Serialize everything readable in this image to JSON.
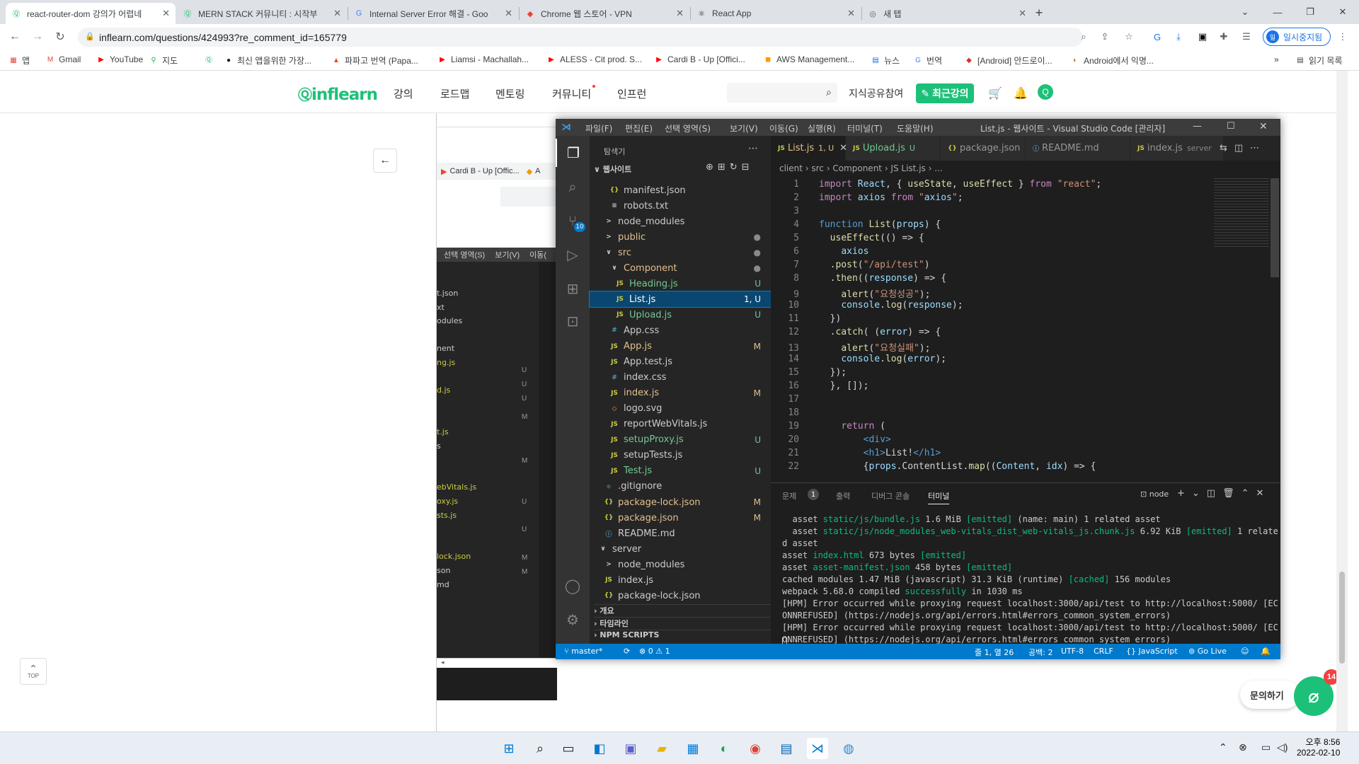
{
  "browser": {
    "tabs": [
      {
        "title": "react-router-dom 강의가 어렵네",
        "favicon": "inflearn-icon",
        "active": true
      },
      {
        "title": "MERN STACK 커뮤니티 : 시작부",
        "favicon": "inflearn-icon",
        "active": false
      },
      {
        "title": "Internal Server Error 해결 - Goo",
        "favicon": "google-icon",
        "active": false
      },
      {
        "title": "Chrome 웹 스토어 - VPN",
        "favicon": "chrome-store-icon",
        "active": false
      },
      {
        "title": "React App",
        "favicon": "react-icon",
        "active": false
      },
      {
        "title": "새 탭",
        "favicon": "chrome-icon",
        "active": false
      }
    ],
    "url": "inflearn.com/questions/424993?re_comment_id=165779",
    "profile_label": "일시중지됨",
    "bookmarks": [
      "앱",
      "Gmail",
      "YouTube",
      "지도",
      "",
      "최신 앱을위한 가장...",
      "파파고 번역 (Papa...",
      "Liamsi - Machallah...",
      "ALESS - Cit prod. S...",
      "Cardi B - Up [Offici...",
      "AWS Management...",
      "뉴스",
      "번역",
      "[Android] 안드로이...",
      "Android에서 익명..."
    ],
    "bookmarks_more": "»",
    "reading_list": "읽기 목록"
  },
  "inflearn": {
    "logo": "inflearn",
    "nav": [
      "강의",
      "로드맵",
      "멘토링",
      "커뮤니티",
      "인프런"
    ],
    "share_label": "지식공유참여",
    "recent_label": "최근강의",
    "top_label": "TOP",
    "inquiry_label": "문의하기",
    "inquiry_badge": "14",
    "embedded_tabs": [
      "Cardi B - Up [Offic...",
      "A"
    ],
    "embedded_menu": [
      "선택 영역(S)",
      "보기(V)",
      "이동("
    ],
    "embedded_files": [
      "t.json",
      "xt",
      "odules",
      "",
      "nent",
      "ng.js",
      "",
      "d.js",
      "",
      "",
      "t.js",
      "s",
      "",
      "",
      "ebVitals.js",
      "oxy.js",
      "sts.js",
      "",
      "",
      "lock.json",
      "son",
      "md"
    ],
    "embedded_status": [
      "U",
      "U",
      "U",
      "M",
      "M",
      "U",
      "U",
      "M",
      "M"
    ]
  },
  "vscode": {
    "title": "List.js - 웹사이트 - Visual Studio Code [관리자]",
    "menu": [
      "파일(F)",
      "편집(E)",
      "선택 영역(S)",
      "보기(V)",
      "이동(G)",
      "실행(R)",
      "터미널(T)",
      "도움말(H)"
    ],
    "explorer_title": "탐색기",
    "workspace": "웹사이트",
    "tree": [
      {
        "name": "manifest.json",
        "icon": "{}",
        "indent": 2,
        "status": ""
      },
      {
        "name": "robots.txt",
        "icon": "≡",
        "indent": 2,
        "status": ""
      },
      {
        "name": "node_modules",
        "icon": ">",
        "indent": 1,
        "status": ""
      },
      {
        "name": "public",
        "icon": ">",
        "indent": 1,
        "status": "●"
      },
      {
        "name": "src",
        "icon": "∨",
        "indent": 1,
        "status": "●"
      },
      {
        "name": "Component",
        "icon": "∨",
        "indent": 2,
        "status": "●"
      },
      {
        "name": "Heading.js",
        "icon": "JS",
        "indent": 3,
        "status": "U"
      },
      {
        "name": "List.js",
        "icon": "JS",
        "indent": 3,
        "status": "1, U"
      },
      {
        "name": "Upload.js",
        "icon": "JS",
        "indent": 3,
        "status": "U"
      },
      {
        "name": "App.css",
        "icon": "#",
        "indent": 2,
        "status": ""
      },
      {
        "name": "App.js",
        "icon": "JS",
        "indent": 2,
        "status": "M"
      },
      {
        "name": "App.test.js",
        "icon": "JS",
        "indent": 2,
        "status": ""
      },
      {
        "name": "index.css",
        "icon": "#",
        "indent": 2,
        "status": ""
      },
      {
        "name": "index.js",
        "icon": "JS",
        "indent": 2,
        "status": "M"
      },
      {
        "name": "logo.svg",
        "icon": "◇",
        "indent": 2,
        "status": ""
      },
      {
        "name": "reportWebVitals.js",
        "icon": "JS",
        "indent": 2,
        "status": ""
      },
      {
        "name": "setupProxy.js",
        "icon": "JS",
        "indent": 2,
        "status": "U"
      },
      {
        "name": "setupTests.js",
        "icon": "JS",
        "indent": 2,
        "status": ""
      },
      {
        "name": "Test.js",
        "icon": "JS",
        "indent": 2,
        "status": "U"
      },
      {
        "name": ".gitignore",
        "icon": "◆",
        "indent": 1,
        "status": ""
      },
      {
        "name": "package-lock.json",
        "icon": "{}",
        "indent": 1,
        "status": "M"
      },
      {
        "name": "package.json",
        "icon": "{}",
        "indent": 1,
        "status": "M"
      },
      {
        "name": "README.md",
        "icon": "ⓘ",
        "indent": 1,
        "status": ""
      },
      {
        "name": "server",
        "icon": "∨",
        "indent": 0,
        "status": ""
      },
      {
        "name": "node_modules",
        "icon": ">",
        "indent": 1,
        "status": ""
      },
      {
        "name": "index.js",
        "icon": "JS",
        "indent": 1,
        "status": ""
      },
      {
        "name": "package-lock.json",
        "icon": "{}",
        "indent": 1,
        "status": ""
      }
    ],
    "sections": [
      "개요",
      "타임라인",
      "NPM SCRIPTS"
    ],
    "editor_tabs": [
      {
        "label": "List.js",
        "badge": "1, U",
        "active": true
      },
      {
        "label": "Upload.js",
        "badge": "U",
        "active": false
      },
      {
        "label": "package.json",
        "badge": "",
        "active": false
      },
      {
        "label": "README.md",
        "badge": "",
        "active": false
      },
      {
        "label": "index.js",
        "badge": "server",
        "active": false
      }
    ],
    "breadcrumb": "client › src › Component › JS List.js › ...",
    "code": [
      "import React, { useState, useEffect } from \"react\";",
      "import axios from \"axios\";",
      "",
      "function List(props) {",
      "  useEffect(() => {",
      "    axios",
      "  .post(\"/api/test\")",
      "  .then((response) => {",
      "    alert(\"요청성공\");",
      "    console.log(response);",
      "  })",
      "  .catch( (error) => {",
      "    alert(\"요청실패\");",
      "    console.log(error);",
      "  });",
      "  }, []);",
      "",
      "",
      "    return (",
      "        <div>",
      "        <h1>List!</h1>",
      "        {props.ContentList.map((Content, idx) => {"
    ],
    "panel_tabs": [
      "문제",
      "출력",
      "디버그 콘솔",
      "터미널"
    ],
    "problem_count": "1",
    "terminal_name": "node",
    "terminal": [
      "  asset static/js/bundle.js 1.6 MiB [emitted] (name: main) 1 related asset",
      "  asset static/js/node_modules_web-vitals_dist_web-vitals_js.chunk.js 6.92 KiB [emitted] 1 relate",
      "d asset",
      "asset index.html 673 bytes [emitted]",
      "asset asset-manifest.json 458 bytes [emitted]",
      "cached modules 1.47 MiB (javascript) 31.3 KiB (runtime) [cached] 156 modules",
      "webpack 5.68.0 compiled successfully in 1030 ms",
      "[HPM] Error occurred while proxying request localhost:3000/api/test to http://localhost:5000/ [EC",
      "ONNREFUSED] (https://nodejs.org/api/errors.html#errors_common_system_errors)",
      "[HPM] Error occurred while proxying request localhost:3000/api/test to http://localhost:5000/ [EC",
      "ONNREFUSED] (https://nodejs.org/api/errors.html#errors_common_system_errors)"
    ],
    "status": {
      "branch": "master*",
      "problems": "⊗ 0 ⚠ 1",
      "position": "줄 1, 열 26",
      "spaces": "공백: 2",
      "encoding": "UTF-8",
      "eol": "CRLF",
      "language": "{} JavaScript",
      "golive": "Go Live"
    }
  },
  "taskbar": {
    "time": "오후 8:56",
    "date": "2022-02-10"
  }
}
